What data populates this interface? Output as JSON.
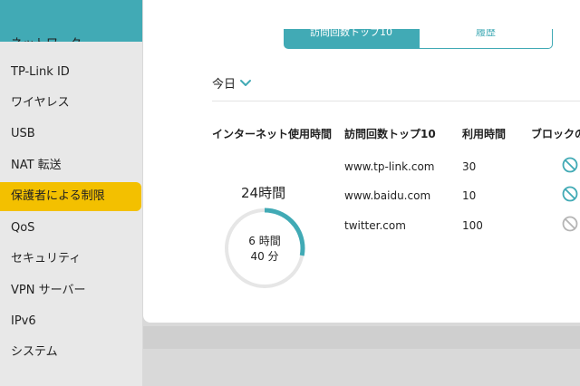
{
  "sidebar": {
    "top_partial": "ネットワーク",
    "items": [
      {
        "label": "TP-Link ID"
      },
      {
        "label": "ワイヤレス"
      },
      {
        "label": "USB"
      },
      {
        "label": "NAT 転送"
      },
      {
        "label": "保護者による制限",
        "active": true
      },
      {
        "label": "QoS"
      },
      {
        "label": "セキュリティ"
      },
      {
        "label": "VPN サーバー"
      },
      {
        "label": "IPv6"
      },
      {
        "label": "システム"
      }
    ]
  },
  "tabs": {
    "top10": "訪問回数トップ10",
    "history": "履歴"
  },
  "day_select": {
    "value": "今日"
  },
  "headers": {
    "usage": "インターネット使用時間",
    "top10": "訪問回数トップ10",
    "time": "利用時間",
    "block": "ブロックの"
  },
  "usage": {
    "limit_label": "24時間",
    "used_hours": "6 時間",
    "used_minutes": "40 分",
    "fraction": 0.28
  },
  "sites": [
    {
      "domain": "www.tp-link.com",
      "time": "30",
      "blocked": true
    },
    {
      "domain": "www.baidu.com",
      "time": "10",
      "blocked": true
    },
    {
      "domain": "twitter.com",
      "time": "100",
      "blocked": false
    }
  ],
  "colors": {
    "accent": "#41aab5",
    "active_nav": "#f3c000",
    "ring_bg": "#e6e6e6",
    "block_on": "#41aab5",
    "block_off": "#b5b5b5"
  }
}
